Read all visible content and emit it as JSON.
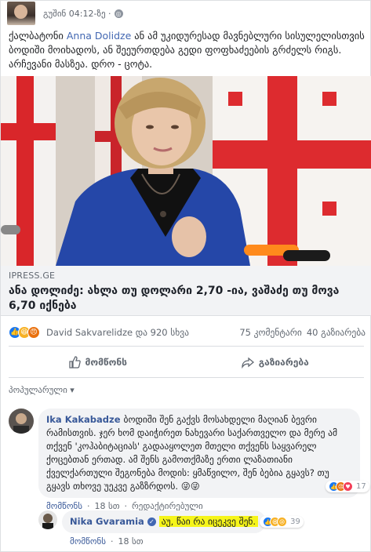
{
  "post": {
    "meta": "გუშინ 04:12-ზე ·",
    "privacy_icon": "globe-icon",
    "text_before": "ქალბატონი ",
    "mention": "Anna Dolidze",
    "text_after": " ან ამ უკიდურესად მავნებლური სისულელისთვის ბოდიში მოიხადოს, ან შეეურთდება გედი ფოფხაძეების გრძელს რიგს. არჩევანი მასზეა. დრო - ცოტა."
  },
  "link_preview": {
    "domain": "IPRESS.GE",
    "title": "ანა დოლიძე: ახლა თუ დოლარი 2,70 -ია, ვაშაძე თუ მოვა 6,70 იქნება"
  },
  "reactions": {
    "summary": "David Sakvarelidze და 920 სხვა",
    "comments": "75 კომენტარი",
    "shares": "40 გაზიარება"
  },
  "actions": {
    "like": "მომწონს",
    "share": "გაზიარება"
  },
  "sort": {
    "label": "პოპულარული ▾"
  },
  "comments": [
    {
      "author": "Ika Kakabadze",
      "text": "ბოდიში შენ გაქვს მოსახდელი მაღიან ბევრი რამისთვის. ჯერ ხომ დაიჭირეთ ნახევარი საქართველო და მერე ამ თქვენ 'კოჰაბიტაციას' გადააყოლეთ მთელი თქვენს საყვარელ ქოცებთან ერთად. ამ შენს გამოთქმაზე ერთი ლაზათიანი ქველქართული შეგონება მოდის: ყმაწვილო, შენ ბებია გყავს? თუ გყავს თხოვე უეკვე გაზზრდოს. 😜😜",
      "like": "მომწონს",
      "time": "18 სთ",
      "edited": "რედაქტირებული",
      "react_count": "17"
    },
    {
      "author": "Nika Gvaramia",
      "text": "აუ, წაი რა იცეკვე შენ.",
      "like": "მომწონს",
      "time": "18 სთ",
      "react_count": "39"
    }
  ],
  "colors": {
    "link": "#385898",
    "mention": "#4267b2",
    "highlight": "#f6f51a",
    "like_blue": "#1877f2"
  }
}
